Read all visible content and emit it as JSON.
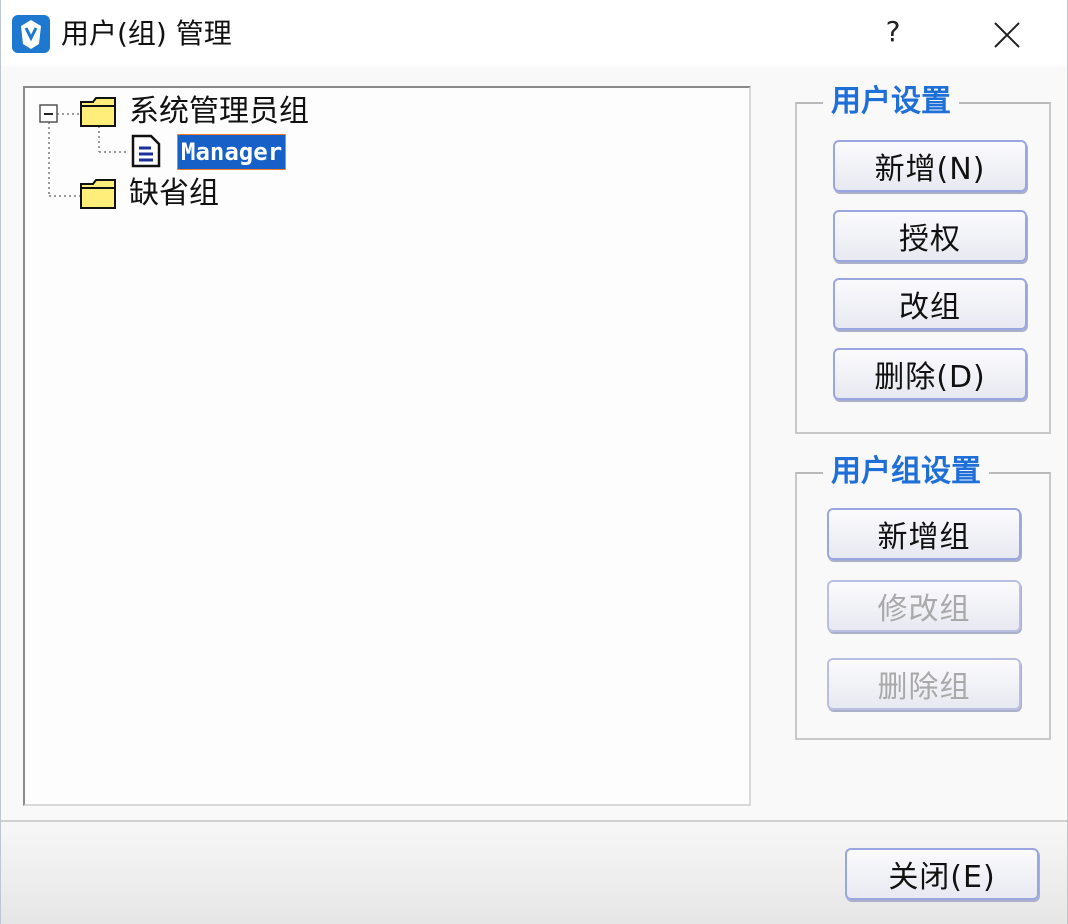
{
  "window": {
    "title": "用户(组) 管理",
    "help_label": "?",
    "close_icon": "close-icon"
  },
  "tree": {
    "groups": [
      {
        "label": "系统管理员组",
        "expanded": true,
        "expander_symbol": "⊟",
        "icon": "folder-icon",
        "users": [
          {
            "label": "Manager",
            "icon": "document-icon",
            "selected": true
          }
        ]
      },
      {
        "label": "缺省组",
        "expanded": false,
        "icon": "folder-icon",
        "users": []
      }
    ]
  },
  "user_settings": {
    "legend": "用户设置",
    "buttons": [
      {
        "label": "新增(N)",
        "enabled": true
      },
      {
        "label": "授权",
        "enabled": true
      },
      {
        "label": "改组",
        "enabled": true
      },
      {
        "label": "删除(D)",
        "enabled": true
      }
    ]
  },
  "group_settings": {
    "legend": "用户组设置",
    "buttons": [
      {
        "label": "新增组",
        "enabled": true
      },
      {
        "label": "修改组",
        "enabled": false
      },
      {
        "label": "删除组",
        "enabled": false
      }
    ]
  },
  "footer": {
    "close_label": "关闭(E)"
  },
  "colors": {
    "legend": "#1f6fd8",
    "selection": "#1660c8",
    "folder": "#ffee7a",
    "button_border": "#9aa6e0"
  }
}
